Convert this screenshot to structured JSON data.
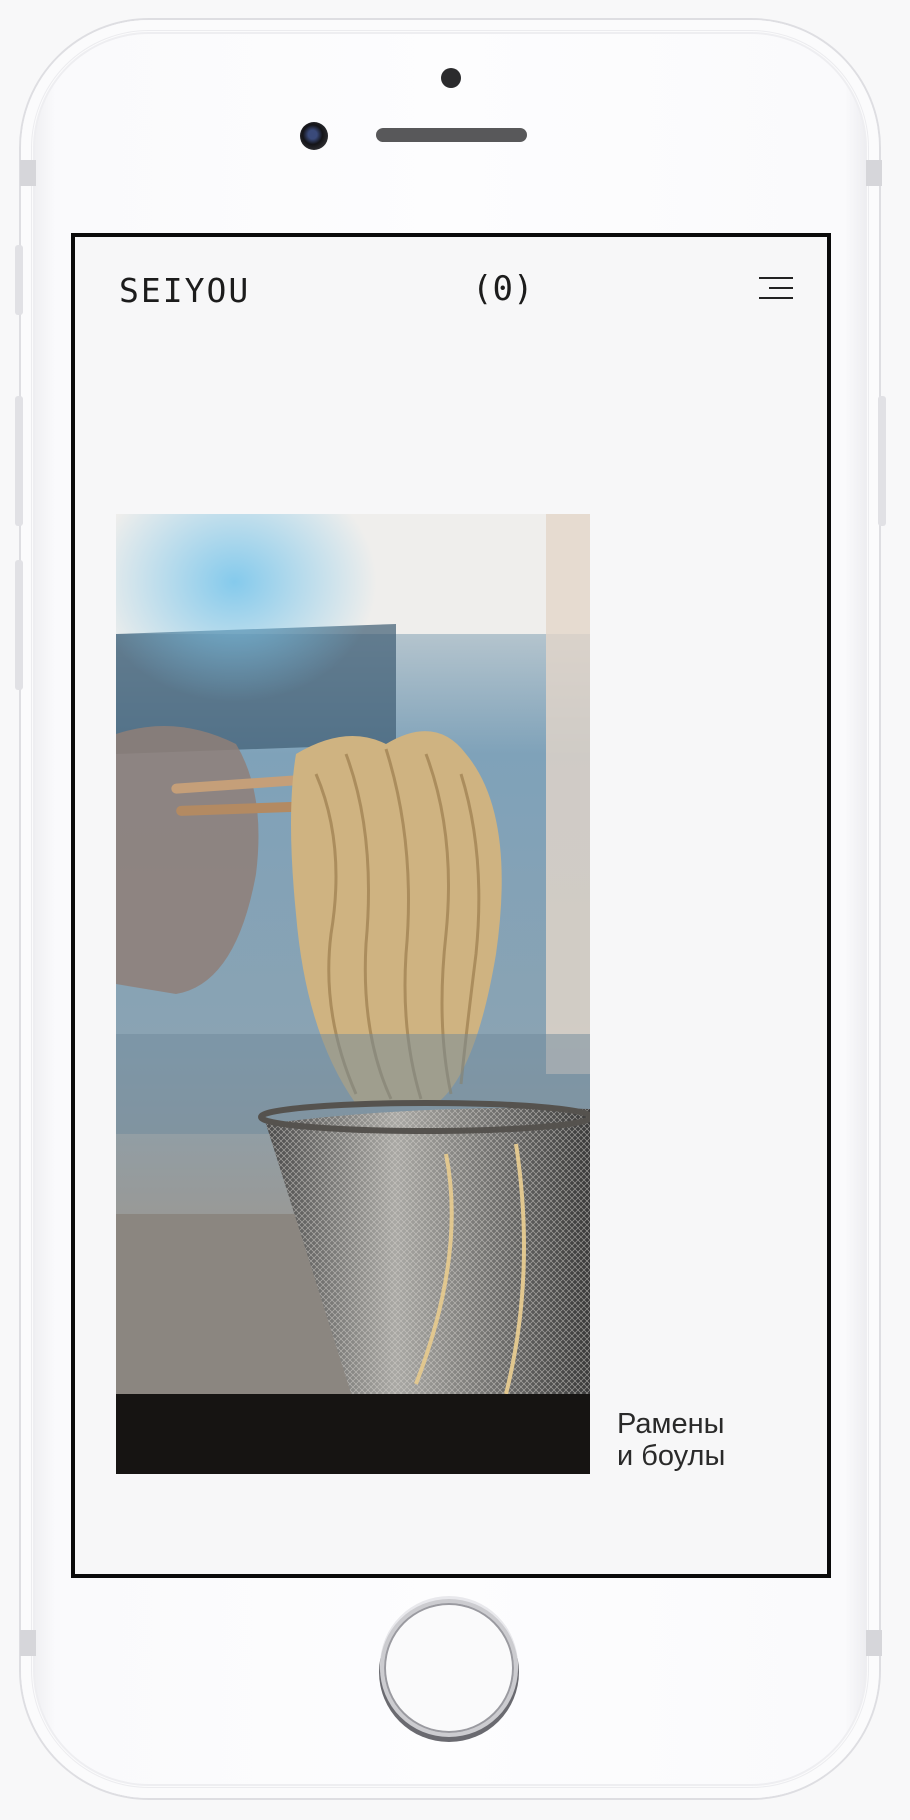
{
  "header": {
    "brand": "SEIYOU",
    "cart_label": "(0)"
  },
  "icons": {
    "menu": "hamburger-menu-icon"
  },
  "hero": {
    "image_alt": "Noodles lifted with chopsticks from a mesh strainer",
    "caption_line1": "Рамены",
    "caption_line2": "и боулы"
  },
  "colors": {
    "frame": "#0a0a0a",
    "screen_bg": "#f7f7f8",
    "text": "#1c1c1c"
  }
}
